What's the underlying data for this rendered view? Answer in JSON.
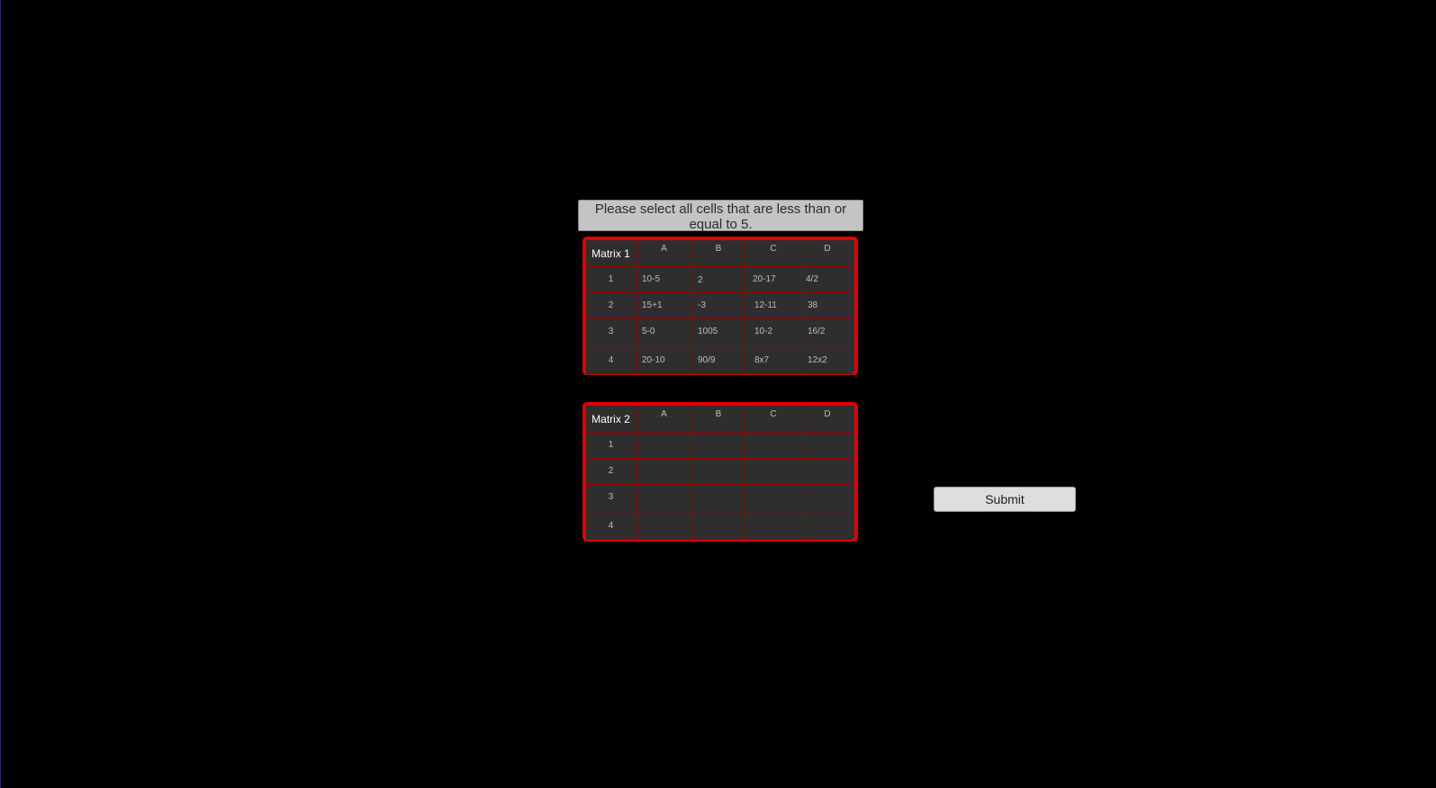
{
  "instruction": {
    "text": "Please select all cells that are less than or equal to 5."
  },
  "matrix1": {
    "title": "Matrix 1",
    "columns": [
      "A",
      "B",
      "C",
      "D"
    ],
    "rows": [
      "1",
      "2",
      "3",
      "4"
    ],
    "cells": [
      [
        "10-5",
        "2",
        "20-17",
        "4/2"
      ],
      [
        "15+1",
        "-3",
        "12-11",
        "38"
      ],
      [
        "5-0",
        "1005",
        "10-2",
        "16/2"
      ],
      [
        "20-10",
        "90/9",
        "8x7",
        "12x2"
      ]
    ]
  },
  "matrix2": {
    "title": "Matrix 2",
    "columns": [
      "A",
      "B",
      "C",
      "D"
    ],
    "rows": [
      "1",
      "2",
      "3",
      "4"
    ],
    "cells": [
      [
        "",
        "",
        "",
        ""
      ],
      [
        "",
        "",
        "",
        ""
      ],
      [
        "",
        "",
        "",
        ""
      ],
      [
        "",
        "",
        "",
        ""
      ]
    ]
  },
  "submit": {
    "label": "Submit"
  },
  "colors": {
    "background": "#000000",
    "matrix_border": "#e00000",
    "grid_line": "#9a0000",
    "cell_background": "#2e2e2e",
    "instruction_background": "#c4c4c4",
    "button_background": "#dedede"
  }
}
